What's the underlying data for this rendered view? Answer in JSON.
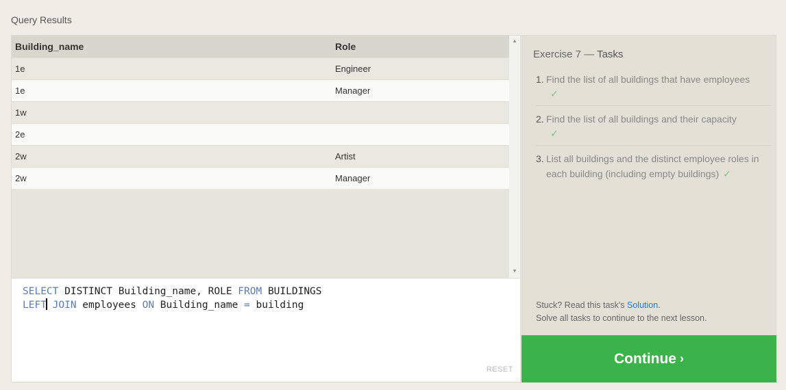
{
  "results": {
    "title": "Query Results",
    "columns": [
      "Building_name",
      "Role"
    ],
    "rows": [
      [
        "1e",
        "Engineer"
      ],
      [
        "1e",
        "Manager"
      ],
      [
        "1w",
        ""
      ],
      [
        "2e",
        ""
      ],
      [
        "2w",
        "Artist"
      ],
      [
        "2w",
        "Manager"
      ]
    ]
  },
  "editor": {
    "line1": {
      "k1": "SELECT",
      "t1": " DISTINCT Building_name, ROLE ",
      "k2": "FROM",
      "t2": " BUILDINGS"
    },
    "line2": {
      "k1": "LEFT",
      "k2": "JOIN",
      "t1": " employees ",
      "k3": "ON",
      "t2": " Building_name ",
      "k4": "=",
      "t3": " building"
    },
    "reset_label": "RESET"
  },
  "tasks": {
    "title_prefix": "Exercise 7 — ",
    "title_bold": "Tasks",
    "items": [
      {
        "num": "1.",
        "text": "Find the list of all buildings that have employees",
        "done": true
      },
      {
        "num": "2.",
        "text": "Find the list of all buildings and their capacity",
        "done": true
      },
      {
        "num": "3.",
        "text": "List all buildings and the distinct employee roles in each building (including empty buildings)",
        "done": true
      }
    ],
    "check_glyph": "✓",
    "help_prefix": "Stuck? Read this task's ",
    "solution_label": "Solution",
    "help_suffix": ".",
    "help_line2": "Solve all tasks to continue to the next lesson."
  },
  "continue_button": {
    "label": "Continue",
    "chevron": "›"
  },
  "colors": {
    "accent_green": "#3cb34a",
    "link_blue": "#2a77c9",
    "keyword_blue": "#5b7bb5",
    "check_green": "#7cc47a"
  }
}
